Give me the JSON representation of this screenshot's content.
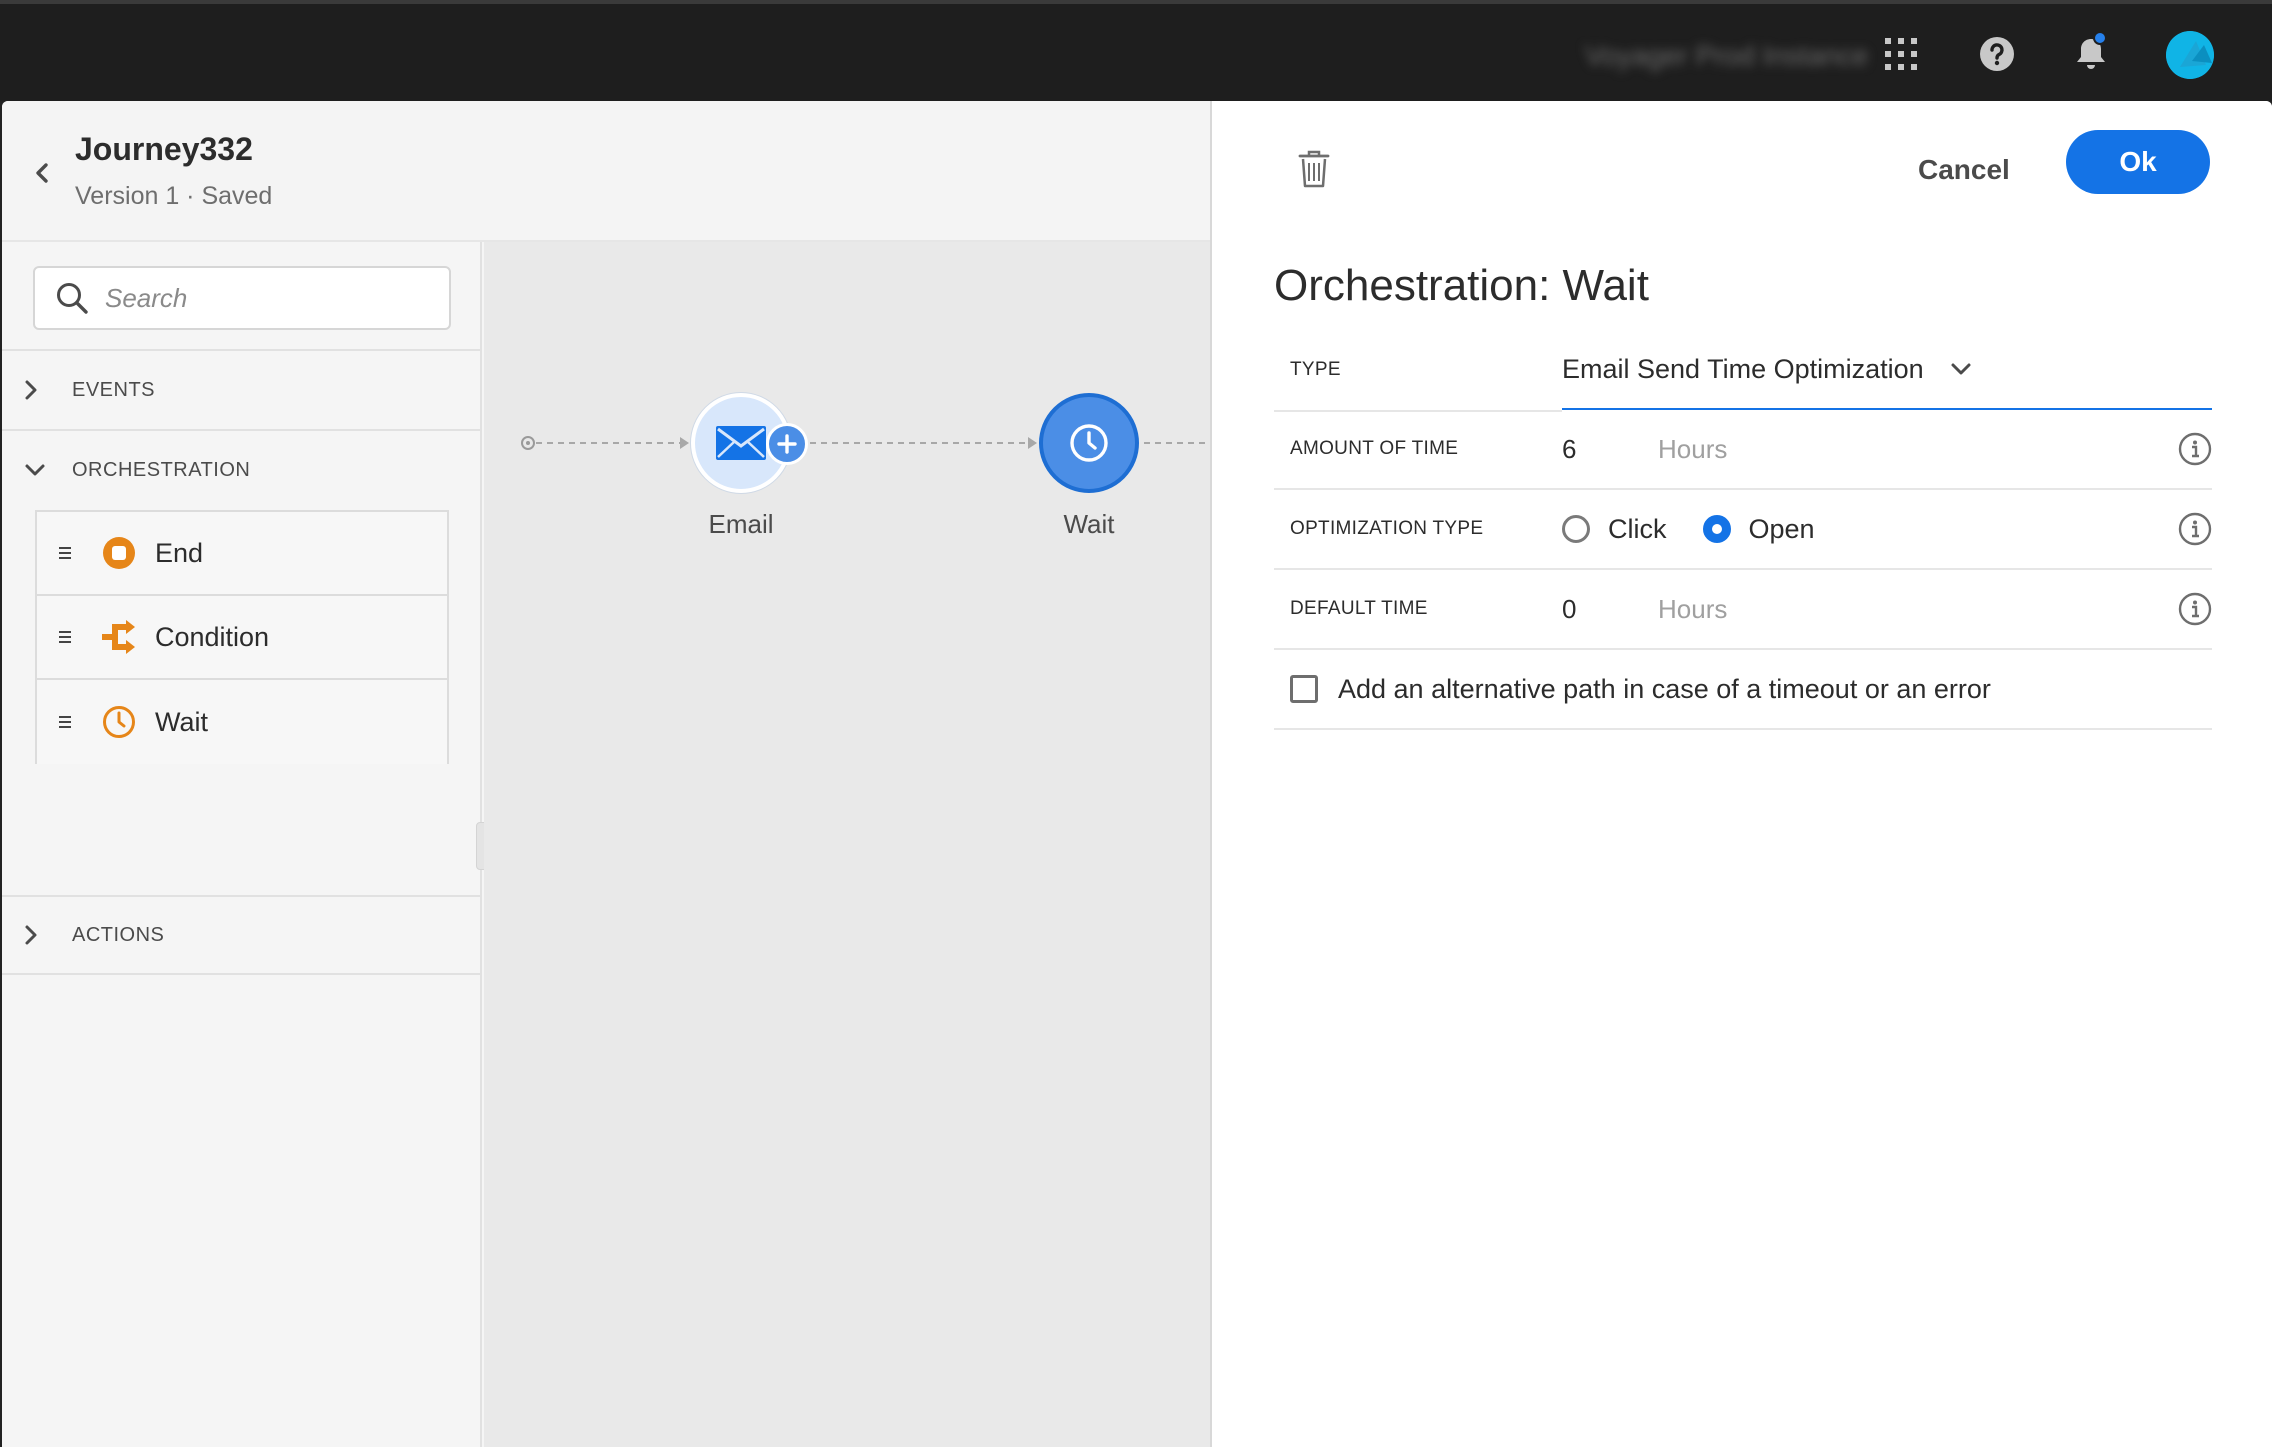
{
  "topbar": {
    "instance_name": "Voyager Prod Instance",
    "icons": [
      "apps-grid-icon",
      "help-icon",
      "notification-bell-icon",
      "user-avatar"
    ],
    "notification_dot_color": "#2680eb",
    "avatar_color": "#10b4e6"
  },
  "journey": {
    "title": "Journey332",
    "version": "Version 1 · Saved"
  },
  "palette": {
    "search_placeholder": "Search",
    "sections": {
      "events": "EVENTS",
      "orchestration": "ORCHESTRATION",
      "actions": "ACTIONS"
    },
    "orchestration_items": [
      {
        "label": "End",
        "icon": "end-icon"
      },
      {
        "label": "Condition",
        "icon": "condition-icon"
      },
      {
        "label": "Wait",
        "icon": "clock-icon"
      }
    ],
    "accent_color": "#e68619"
  },
  "canvas": {
    "nodes": [
      {
        "label": "Email",
        "icon": "envelope-icon"
      },
      {
        "label": "Wait",
        "icon": "clock-icon"
      }
    ]
  },
  "panel": {
    "cancel_label": "Cancel",
    "ok_label": "Ok",
    "title": "Orchestration: Wait",
    "fields": {
      "type": {
        "label": "TYPE",
        "value": "Email Send Time Optimization"
      },
      "amount_of_time": {
        "label": "AMOUNT OF TIME",
        "value": "6",
        "unit": "Hours"
      },
      "optimization_type": {
        "label": "OPTIMIZATION TYPE",
        "options": [
          "Click",
          "Open"
        ],
        "selected": "Open"
      },
      "default_time": {
        "label": "DEFAULT TIME",
        "value": "0",
        "unit": "Hours"
      }
    },
    "alternative_path": {
      "label": "Add an alternative path in case of a timeout or an error",
      "checked": false
    },
    "primary_color": "#1473e6"
  }
}
